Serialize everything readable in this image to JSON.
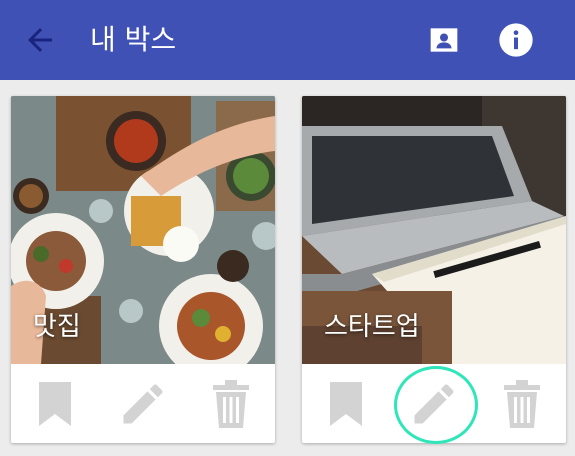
{
  "app_bar": {
    "title": "내 박스",
    "back_icon": "arrow-back-icon",
    "actions": [
      {
        "icon": "contact-card-icon"
      },
      {
        "icon": "info-icon"
      }
    ],
    "background_color": "#3f51b5"
  },
  "cards": [
    {
      "title": "맛집",
      "image": "food-table-photo",
      "actions": [
        {
          "icon": "bookmark-icon"
        },
        {
          "icon": "edit-pencil-icon"
        },
        {
          "icon": "trash-icon"
        }
      ]
    },
    {
      "title": "스타트업",
      "image": "laptop-notebook-photo",
      "actions": [
        {
          "icon": "bookmark-icon"
        },
        {
          "icon": "edit-pencil-icon",
          "highlighted": true
        },
        {
          "icon": "trash-icon"
        }
      ]
    }
  ],
  "colors": {
    "icon_gray": "#d3d3d3",
    "highlight_ring": "#2fe6b8"
  }
}
